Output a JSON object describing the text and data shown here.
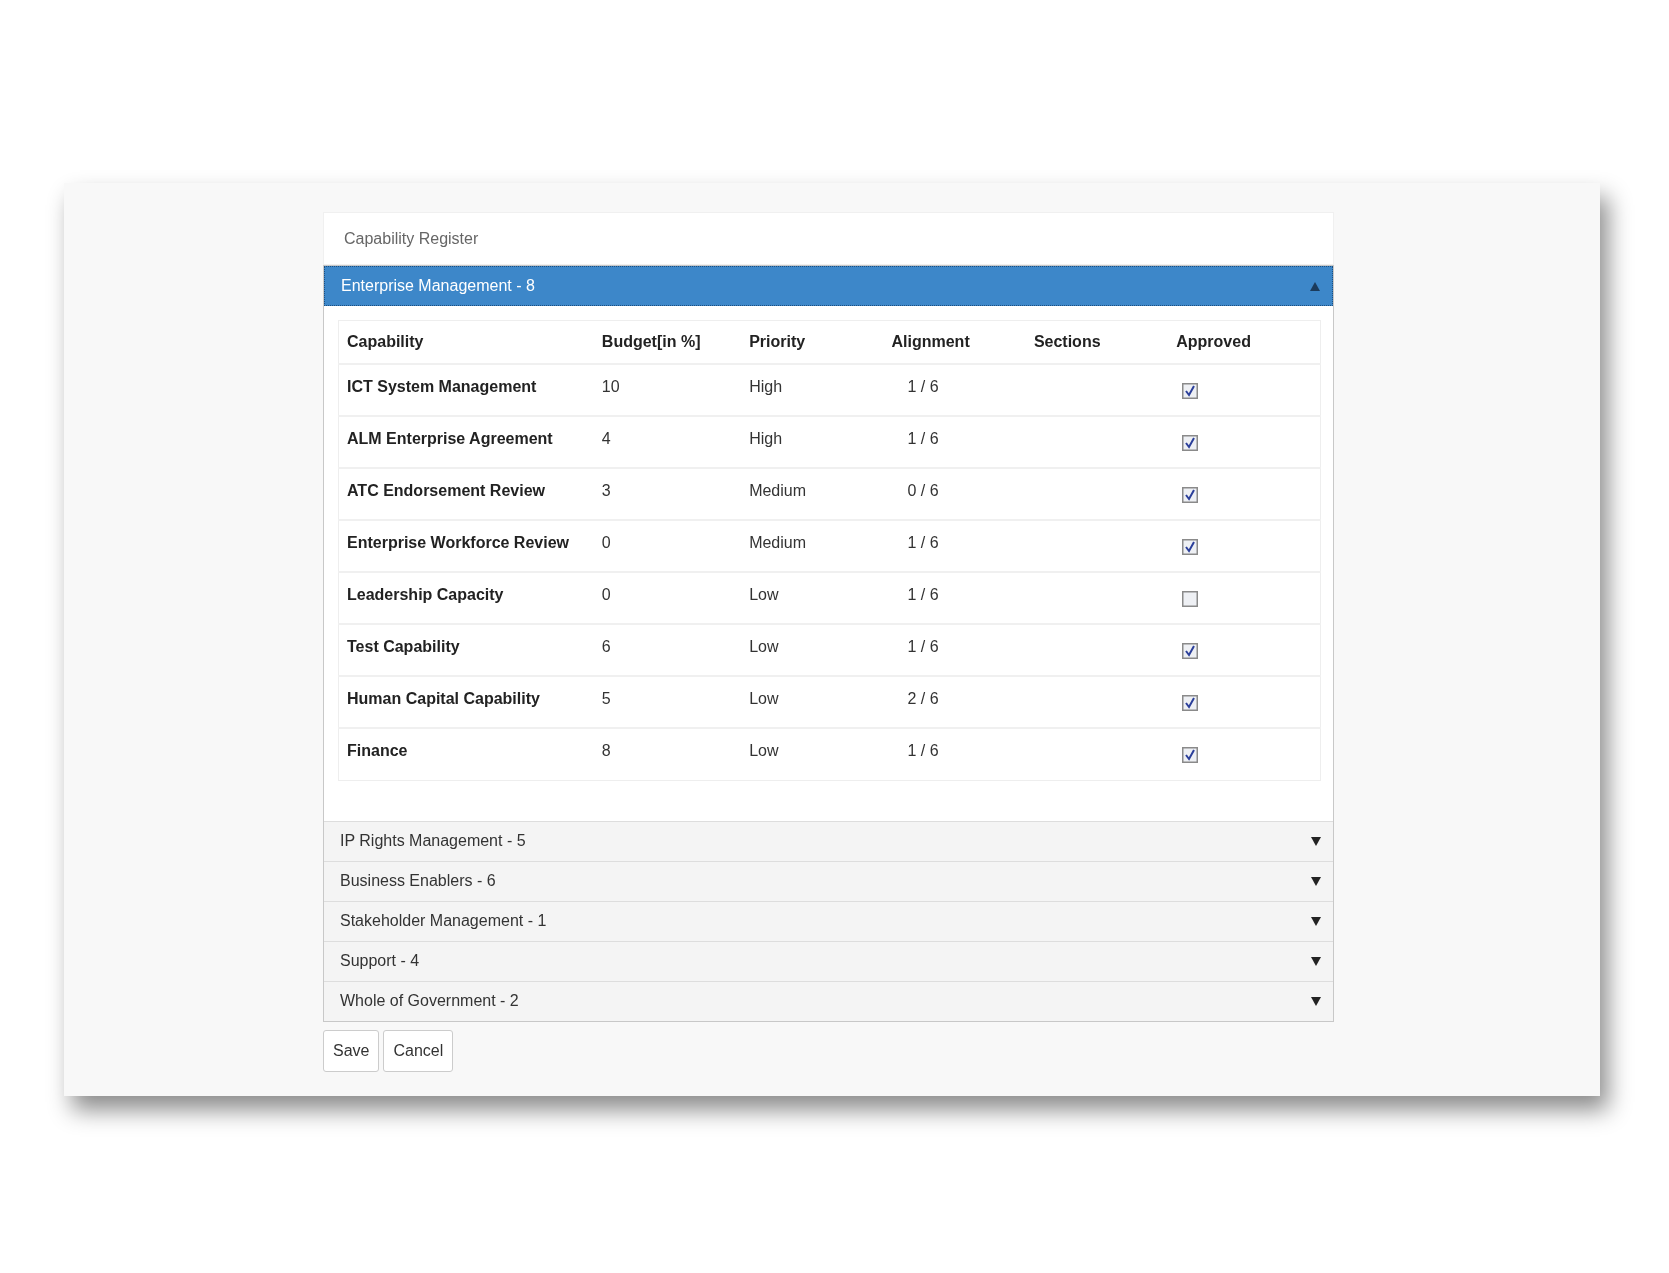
{
  "panel": {
    "title": "Capability Register"
  },
  "sections": [
    {
      "title": "Enterprise Management - 8",
      "expanded": true,
      "table": {
        "columns": [
          "Capability",
          "Budget[in %]",
          "Priority",
          "Alignment",
          "Sections",
          "Approved"
        ],
        "rows": [
          {
            "capability": "ICT System Management",
            "budget": "10",
            "priority": "High",
            "alignment": "1 / 6",
            "approved": true
          },
          {
            "capability": "ALM Enterprise Agreement",
            "budget": "4",
            "priority": "High",
            "alignment": "1 / 6",
            "approved": true
          },
          {
            "capability": "ATC Endorsement Review",
            "budget": "3",
            "priority": "Medium",
            "alignment": "0 / 6",
            "approved": true
          },
          {
            "capability": "Enterprise Workforce Review",
            "budget": "0",
            "priority": "Medium",
            "alignment": "1 / 6",
            "approved": true
          },
          {
            "capability": "Leadership Capacity",
            "budget": "0",
            "priority": "Low",
            "alignment": "1 / 6",
            "approved": false
          },
          {
            "capability": "Test Capability",
            "budget": "6",
            "priority": "Low",
            "alignment": "1 / 6",
            "approved": true
          },
          {
            "capability": "Human Capital Capability",
            "budget": "5",
            "priority": "Low",
            "alignment": "2 / 6",
            "approved": true
          },
          {
            "capability": "Finance",
            "budget": "8",
            "priority": "Low",
            "alignment": "1 / 6",
            "approved": true
          }
        ]
      }
    },
    {
      "title": "IP Rights Management - 5",
      "expanded": false
    },
    {
      "title": "Business Enablers - 6",
      "expanded": false
    },
    {
      "title": "Stakeholder Management - 1",
      "expanded": false
    },
    {
      "title": "Support - 4",
      "expanded": false
    },
    {
      "title": "Whole of Government - 2",
      "expanded": false
    }
  ],
  "buttons": [
    "Save",
    "Cancel"
  ]
}
